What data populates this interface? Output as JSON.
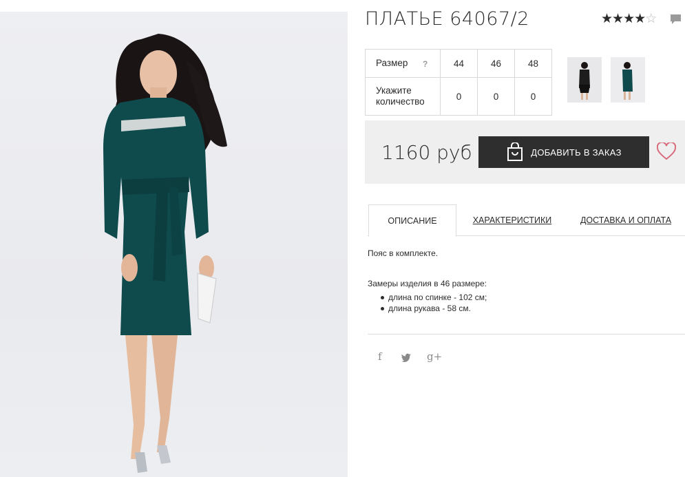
{
  "product": {
    "title": "ПЛАТЬЕ 64067/2",
    "rating": 4,
    "rating_max": 5,
    "star_glyph": "★",
    "star_empty_glyph": "☆"
  },
  "icons": {
    "comment": "comment-icon",
    "bag": "shopping-bag-icon",
    "heart": "heart-icon",
    "facebook": "facebook-icon",
    "twitter": "twitter-icon",
    "gplus": "google-plus-icon"
  },
  "sizes": {
    "size_label": "Размер",
    "help": "?",
    "qty_label": "Укажите количество",
    "items": [
      {
        "size": "44",
        "qty": "0"
      },
      {
        "size": "46",
        "qty": "0"
      },
      {
        "size": "48",
        "qty": "0"
      }
    ]
  },
  "buy": {
    "price": "1160 руб",
    "add_label": "ДОБАВИТЬ В ЗАКАЗ"
  },
  "tabs": [
    {
      "label": "ОПИСАНИЕ"
    },
    {
      "label": "ХАРАКТЕРИСТИКИ"
    },
    {
      "label": "ДОСТАВКА И ОПЛАТА"
    }
  ],
  "description": {
    "text": "Пояс в комплекте.",
    "measure_title": "Замеры изделия в 46 размере:",
    "measures": [
      "длина по спинке - 102 см;",
      "длина рукава - 58 см."
    ]
  },
  "social": {
    "facebook": "f",
    "twitter": "t",
    "gplus": "g+"
  },
  "colors": {
    "dress": "#0f4a4c",
    "button": "#2e2e2e",
    "heart": "#d86a7c",
    "panel": "#efefef"
  }
}
